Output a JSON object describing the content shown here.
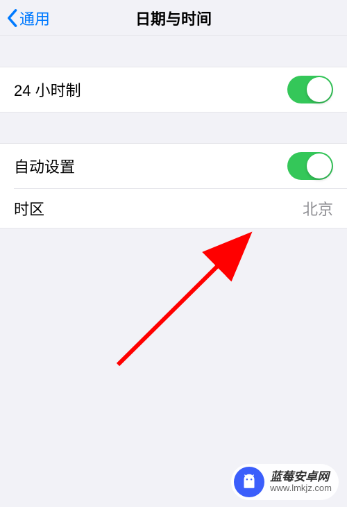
{
  "header": {
    "back_label": "通用",
    "title": "日期与时间"
  },
  "groups": [
    {
      "rows": [
        {
          "label": "24 小时制",
          "type": "toggle",
          "on": true
        }
      ]
    },
    {
      "rows": [
        {
          "label": "自动设置",
          "type": "toggle",
          "on": true
        },
        {
          "label": "时区",
          "type": "value",
          "value": "北京"
        }
      ]
    }
  ],
  "watermark": {
    "title": "蓝莓安卓网",
    "url": "www.lmkjz.com"
  },
  "colors": {
    "accent": "#007aff",
    "toggle_on": "#34c759",
    "arrow": "#ff0000"
  }
}
